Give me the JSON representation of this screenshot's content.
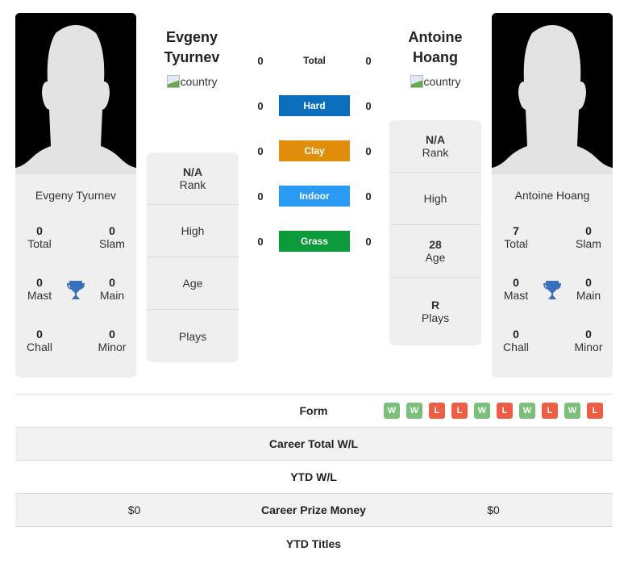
{
  "player1": {
    "name": "Evgeny Tyurnev",
    "name_line1": "Evgeny",
    "name_line2": "Tyurnev",
    "flag_alt": "country",
    "stats": {
      "total": {
        "value": "0",
        "label": "Total"
      },
      "slam": {
        "value": "0",
        "label": "Slam"
      },
      "mast": {
        "value": "0",
        "label": "Mast"
      },
      "main": {
        "value": "0",
        "label": "Main"
      },
      "chall": {
        "value": "0",
        "label": "Chall"
      },
      "minor": {
        "value": "0",
        "label": "Minor"
      }
    },
    "info": {
      "rank": {
        "value": "N/A",
        "label": "Rank"
      },
      "high": {
        "value": "",
        "label": "High"
      },
      "age": {
        "value": "",
        "label": "Age"
      },
      "plays": {
        "value": "",
        "label": "Plays"
      }
    }
  },
  "player2": {
    "name": "Antoine Hoang",
    "name_line1": "Antoine",
    "name_line2": "Hoang",
    "flag_alt": "country",
    "stats": {
      "total": {
        "value": "7",
        "label": "Total"
      },
      "slam": {
        "value": "0",
        "label": "Slam"
      },
      "mast": {
        "value": "0",
        "label": "Mast"
      },
      "main": {
        "value": "0",
        "label": "Main"
      },
      "chall": {
        "value": "0",
        "label": "Chall"
      },
      "minor": {
        "value": "0",
        "label": "Minor"
      }
    },
    "info": {
      "rank": {
        "value": "N/A",
        "label": "Rank"
      },
      "high": {
        "value": "",
        "label": "High"
      },
      "age": {
        "value": "28",
        "label": "Age"
      },
      "plays": {
        "value": "R",
        "label": "Plays"
      }
    }
  },
  "h2h": [
    {
      "label": "Total",
      "p1": "0",
      "p2": "0",
      "color": ""
    },
    {
      "label": "Hard",
      "p1": "0",
      "p2": "0",
      "color": "#0a6ebd"
    },
    {
      "label": "Clay",
      "p1": "0",
      "p2": "0",
      "color": "#e08e0b"
    },
    {
      "label": "Indoor",
      "p1": "0",
      "p2": "0",
      "color": "#2b9af3"
    },
    {
      "label": "Grass",
      "p1": "0",
      "p2": "0",
      "color": "#0c9a3b"
    }
  ],
  "table": {
    "form_label": "Form",
    "form": [
      "W",
      "W",
      "L",
      "L",
      "W",
      "L",
      "W",
      "L",
      "W",
      "L"
    ],
    "form_colors": {
      "W": "#7abf7a",
      "L": "#ee5e45"
    },
    "rows": [
      {
        "label": "Career Total W/L",
        "p1": "",
        "p2": ""
      },
      {
        "label": "YTD W/L",
        "p1": "",
        "p2": ""
      },
      {
        "label": "Career Prize Money",
        "p1": "$0",
        "p2": "$0"
      },
      {
        "label": "YTD Titles",
        "p1": "",
        "p2": ""
      }
    ]
  },
  "colors": {
    "trophy": "#3a6fbf"
  }
}
